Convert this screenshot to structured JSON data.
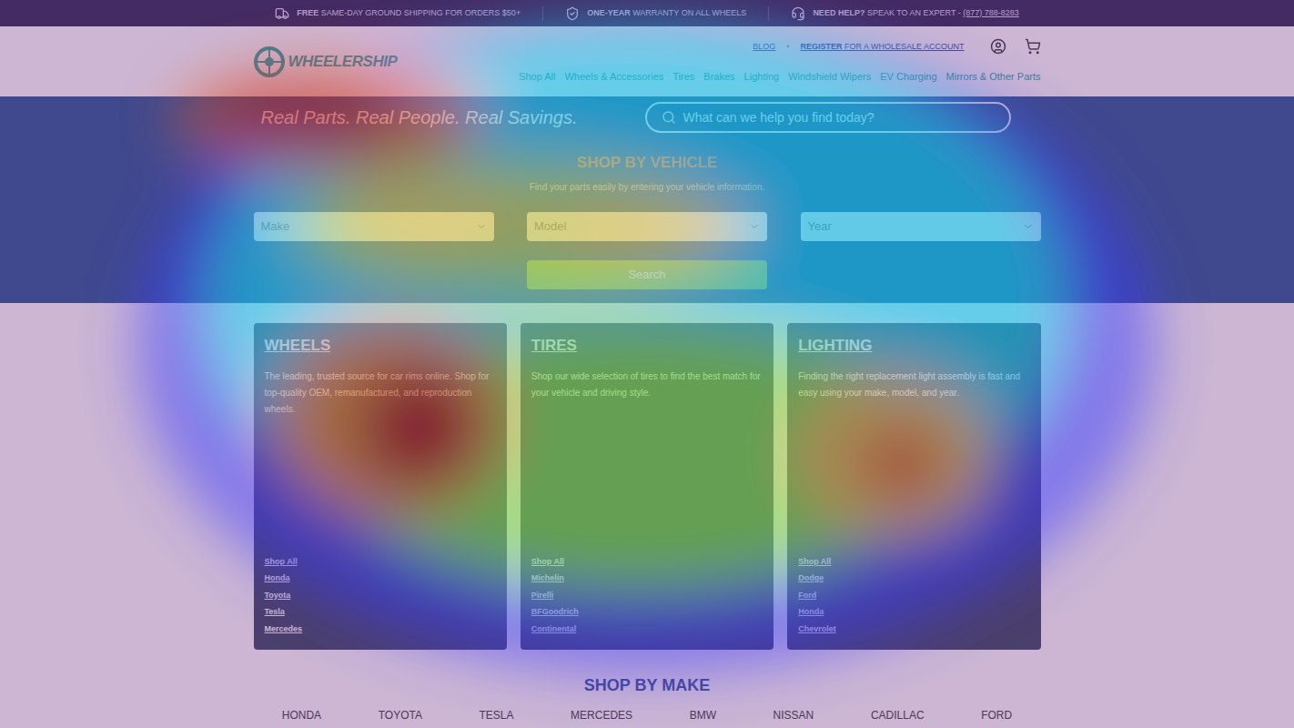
{
  "top_bar": [
    {
      "bold": "FREE",
      "text": "SAME-DAY GROUND SHIPPING FOR ORDERS $50+",
      "link": ""
    },
    {
      "bold": "ONE-YEAR",
      "text": "WARRANTY ON ALL WHEELS",
      "link": ""
    },
    {
      "bold": "NEED HELP?",
      "text": "SPEAK TO AN EXPERT -",
      "link": "(877) 788-8283"
    }
  ],
  "logo": "WHEELERSHIP",
  "utility_links": [
    {
      "bold": "",
      "label": "BLOG"
    },
    {
      "bold": "REGISTER",
      "label": "FOR A WHOLESALE ACCOUNT"
    }
  ],
  "utility_separator": "•",
  "nav": [
    "Shop All",
    "Wheels & Accessories",
    "Tires",
    "Brakes",
    "Lighting",
    "Windshield Wipers",
    "EV Charging",
    "Mirrors & Other Parts"
  ],
  "hero": {
    "tagline": "Real Parts. Real People. Real Savings.",
    "search_placeholder": "What can we help you find today?",
    "title": "SHOP BY VEHICLE",
    "subtitle": "Find your parts easily by entering your vehicle information.",
    "selects": [
      "Make",
      "Model",
      "Year"
    ],
    "button": "Search"
  },
  "cards": [
    {
      "title": "WHEELS",
      "description": "The leading, trusted source for car rims online. Shop for top-quality OEM, remanufactured, and reproduction wheels.",
      "links": [
        "Shop All",
        "Honda",
        "Toyota",
        "Tesla",
        "Mercedes"
      ]
    },
    {
      "title": "TIRES",
      "description": "Shop our wide selection of tires to find the best match for your vehicle and driving style.",
      "links": [
        "Shop All",
        "Michelin",
        "Pirelli",
        "BFGoodrich",
        "Continental"
      ]
    },
    {
      "title": "LIGHTING",
      "description": "Finding the right replacement light assembly is fast and easy using your make, model, and year.",
      "links": [
        "Shop All",
        "Dodge",
        "Ford",
        "Honda",
        "Chevrolet"
      ]
    }
  ],
  "shop_by_make": {
    "title": "SHOP BY MAKE",
    "makes": [
      "HONDA",
      "TOYOTA",
      "TESLA",
      "MERCEDES",
      "BMW",
      "NISSAN",
      "CADILLAC",
      "FORD"
    ]
  }
}
